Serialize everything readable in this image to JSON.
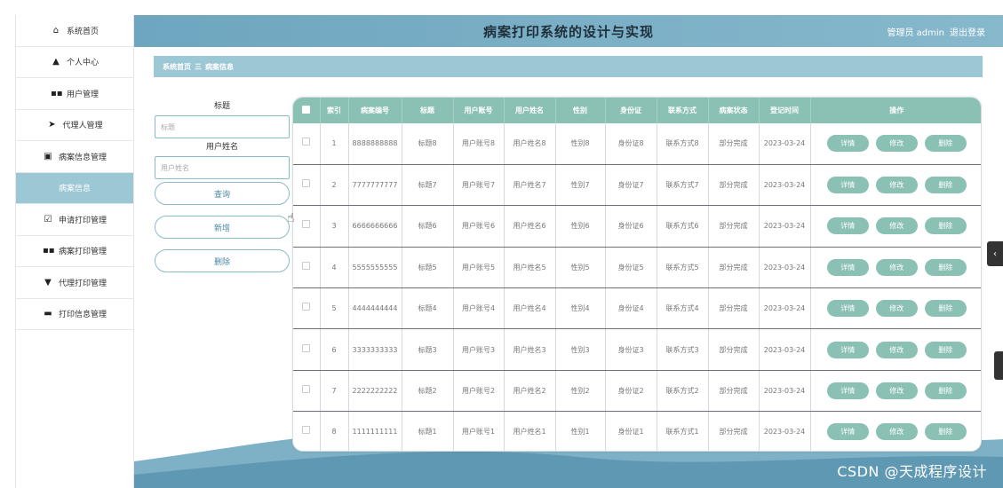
{
  "header": {
    "title": "病案打印系统的设计与实现",
    "user": "管理员 admin",
    "logout": "退出登录"
  },
  "sidebar": {
    "items": [
      {
        "icon": "home-icon",
        "glyph": "⌂",
        "label": "系统首页"
      },
      {
        "icon": "person-icon",
        "glyph": "▲",
        "label": "个人中心"
      },
      {
        "icon": "grid-icon",
        "glyph": "▪▪",
        "label": "用户管理"
      },
      {
        "icon": "send-icon",
        "glyph": "➤",
        "label": "代理人管理"
      },
      {
        "icon": "clipboard-icon",
        "glyph": "▣",
        "label": "病案信息管理"
      },
      {
        "icon": "",
        "glyph": "",
        "label": "病案信息"
      },
      {
        "icon": "check-icon",
        "glyph": "☑",
        "label": "申请打印管理"
      },
      {
        "icon": "grid-icon",
        "glyph": "▪▪",
        "label": "病案打印管理"
      },
      {
        "icon": "printer-icon",
        "glyph": "▼",
        "label": "代理打印管理"
      },
      {
        "icon": "ticket-icon",
        "glyph": "▬",
        "label": "打印信息管理"
      }
    ]
  },
  "breadcrumb": {
    "home": "系统首页",
    "sep": "三",
    "current": "病案信息"
  },
  "search": {
    "title_label": "标题",
    "title_placeholder": "标题",
    "name_label": "用户姓名",
    "name_placeholder": "用户姓名",
    "query_btn": "查询",
    "add_btn": "新增",
    "delete_btn": "删除"
  },
  "table": {
    "columns": [
      "索引",
      "病案编号",
      "标题",
      "用户账号",
      "用户姓名",
      "性别",
      "身份证",
      "联系方式",
      "病案状态",
      "登记时间",
      "操作"
    ],
    "actions": {
      "detail": "详情",
      "edit": "修改",
      "delete": "删除"
    },
    "rows": [
      {
        "index": "1",
        "code": "8888888888",
        "title": "标题8",
        "account": "用户账号8",
        "name": "用户姓名8",
        "gender": "性别8",
        "idcard": "身份证8",
        "contact": "联系方式8",
        "status": "部分完成",
        "time": "2023-03-24"
      },
      {
        "index": "2",
        "code": "7777777777",
        "title": "标题7",
        "account": "用户账号7",
        "name": "用户姓名7",
        "gender": "性别7",
        "idcard": "身份证7",
        "contact": "联系方式7",
        "status": "部分完成",
        "time": "2023-03-24"
      },
      {
        "index": "3",
        "code": "6666666666",
        "title": "标题6",
        "account": "用户账号6",
        "name": "用户姓名6",
        "gender": "性别6",
        "idcard": "身份证6",
        "contact": "联系方式6",
        "status": "部分完成",
        "time": "2023-03-24"
      },
      {
        "index": "4",
        "code": "5555555555",
        "title": "标题5",
        "account": "用户账号5",
        "name": "用户姓名5",
        "gender": "性别5",
        "idcard": "身份证5",
        "contact": "联系方式5",
        "status": "部分完成",
        "time": "2023-03-24"
      },
      {
        "index": "5",
        "code": "4444444444",
        "title": "标题4",
        "account": "用户账号4",
        "name": "用户姓名4",
        "gender": "性别4",
        "idcard": "身份证4",
        "contact": "联系方式4",
        "status": "部分完成",
        "time": "2023-03-24"
      },
      {
        "index": "6",
        "code": "3333333333",
        "title": "标题3",
        "account": "用户账号3",
        "name": "用户姓名3",
        "gender": "性别3",
        "idcard": "身份证3",
        "contact": "联系方式3",
        "status": "部分完成",
        "time": "2023-03-24"
      },
      {
        "index": "7",
        "code": "2222222222",
        "title": "标题2",
        "account": "用户账号2",
        "name": "用户姓名2",
        "gender": "性别2",
        "idcard": "身份证2",
        "contact": "联系方式2",
        "status": "部分完成",
        "time": "2023-03-24"
      },
      {
        "index": "8",
        "code": "1111111111",
        "title": "标题1",
        "account": "用户账号1",
        "name": "用户姓名1",
        "gender": "性别1",
        "idcard": "身份证1",
        "contact": "联系方式1",
        "status": "部分完成",
        "time": "2023-03-24"
      }
    ]
  },
  "watermark": "CSDN @天成程序设计",
  "colors": {
    "header": "#7aafc4",
    "accent": "#8bc1b5",
    "breadcrumb": "#9cc7d4"
  }
}
